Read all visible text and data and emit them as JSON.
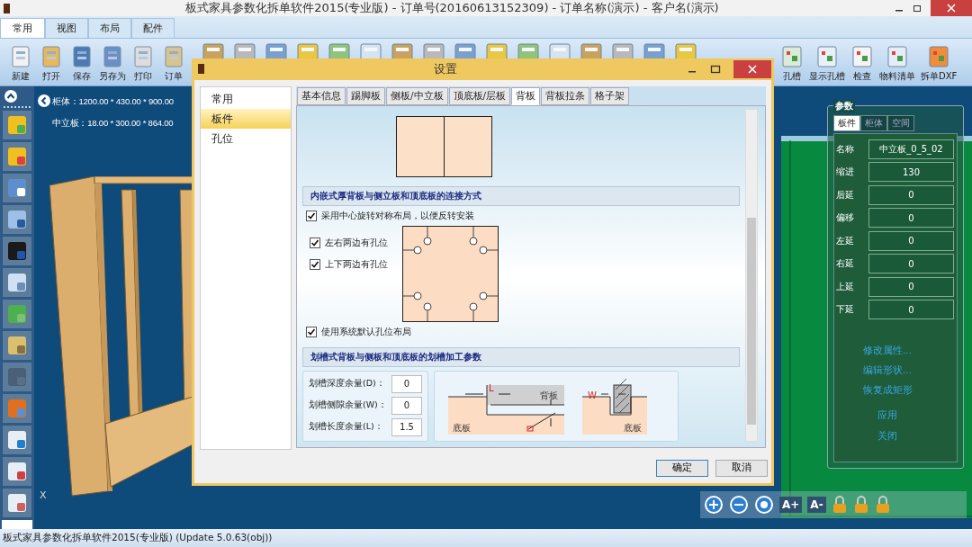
{
  "window": {
    "title": "板式家具参数化拆单软件2015(专业版) - 订单号(20160613152309) - 订单名称(演示) - 客户名(演示)"
  },
  "ribbon_tabs": [
    {
      "label": "常用",
      "selected": true
    },
    {
      "label": "视图",
      "selected": false
    },
    {
      "label": "布局",
      "selected": false
    },
    {
      "label": "配件",
      "selected": false
    }
  ],
  "toolbar": [
    {
      "label": "新建"
    },
    {
      "label": "打开"
    },
    {
      "label": "保存"
    },
    {
      "label": "另存为"
    },
    {
      "label": "打印"
    },
    {
      "label": "订单"
    }
  ],
  "toolbar_right": [
    {
      "label": "孔槽"
    },
    {
      "label": "显示孔槽"
    },
    {
      "label": "检查"
    },
    {
      "label": "物料清单"
    },
    {
      "label": "拆单DXF"
    }
  ],
  "viewport": {
    "cabinet": "柜体：1200.00 * 430.00 * 900.00",
    "panel": "中立板：18.00 * 300.00 * 864.00",
    "axis": "X"
  },
  "params_panel": {
    "title": "参数",
    "tabs": [
      {
        "label": "板件",
        "selected": true
      },
      {
        "label": "柜体",
        "selected": false
      },
      {
        "label": "空间",
        "selected": false
      }
    ],
    "fields": [
      {
        "label": "名称",
        "value": "中立板_0_5_02"
      },
      {
        "label": "缩进",
        "value": "130"
      },
      {
        "label": "后延",
        "value": "0"
      },
      {
        "label": "偏移",
        "value": "0"
      },
      {
        "label": "左延",
        "value": "0"
      },
      {
        "label": "右延",
        "value": "0"
      },
      {
        "label": "上延",
        "value": "0"
      },
      {
        "label": "下延",
        "value": "0"
      }
    ],
    "links": [
      "修改属性...",
      "编辑形状...",
      "恢复成矩形"
    ],
    "actions": [
      "应用",
      "关闭"
    ]
  },
  "zoom_bar": [
    "A+",
    "A-"
  ],
  "dialog": {
    "title": "设置",
    "nav": [
      {
        "label": "常用",
        "selected": false
      },
      {
        "label": "板件",
        "selected": true
      },
      {
        "label": "孔位",
        "selected": false
      }
    ],
    "tabs": [
      {
        "label": "基本信息",
        "selected": false
      },
      {
        "label": "踢脚板",
        "selected": false
      },
      {
        "label": "侧板/中立板",
        "selected": false
      },
      {
        "label": "顶底板/层板",
        "selected": false
      },
      {
        "label": "背板",
        "selected": true
      },
      {
        "label": "背板拉条",
        "selected": false
      },
      {
        "label": "格子架",
        "selected": false
      }
    ],
    "embed_section": {
      "title": "内嵌式厚背板与侧立板和顶底板的连接方式",
      "rotate_option": {
        "label": "采用中心旋转对称布局，以便反转安装",
        "checked": true
      },
      "hole_options": [
        {
          "label": "左右两边有孔位",
          "checked": true
        },
        {
          "label": "上下两边有孔位",
          "checked": true
        }
      ],
      "default_option": {
        "label": "使用系统默认孔位布局",
        "checked": true
      }
    },
    "groove_section": {
      "title": "划槽式背板与侧板和顶底板的划槽加工参数",
      "fields": [
        {
          "label": "划槽深度余量(D)：",
          "value": "0"
        },
        {
          "label": "划槽侧隙余量(W)：",
          "value": "0"
        },
        {
          "label": "划槽长度余量(L)：",
          "value": "1.5"
        }
      ],
      "diagram_labels": {
        "length": "L",
        "back": "背板",
        "bottom": "底板",
        "width": "W",
        "bottom_right": "底板"
      }
    },
    "buttons": [
      "确定",
      "取消"
    ]
  },
  "status_bar": "板式家具参数化拆单软件2015(专业版) (Update 5.0.63(obj))"
}
